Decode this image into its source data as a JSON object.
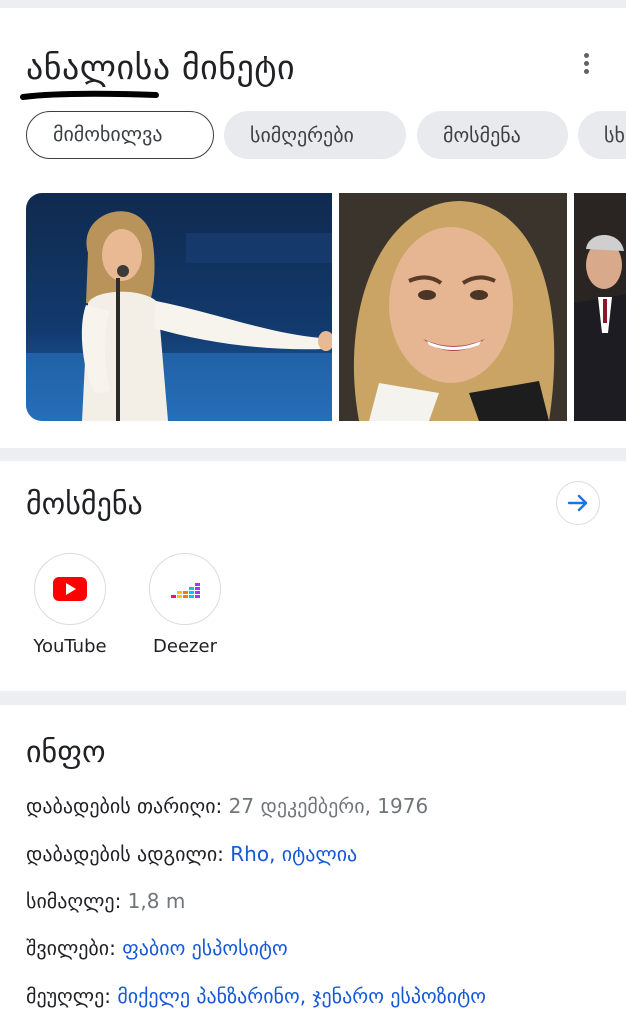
{
  "header": {
    "title": "ანალისა მინეტი",
    "menu_icon": "more-vert-icon"
  },
  "chips": [
    {
      "label": "მიმოხილვა",
      "selected": true
    },
    {
      "label": "სიმღერები",
      "selected": false
    },
    {
      "label": "მოსმენა",
      "selected": false
    },
    {
      "label": "სხ",
      "selected": false
    }
  ],
  "images": [
    {
      "alt": "singer performing on stage with microphone"
    },
    {
      "alt": "portrait close-up"
    },
    {
      "alt": "man in suit"
    }
  ],
  "listen": {
    "title": "მოსმენა",
    "arrow_icon": "arrow-right-icon",
    "sources": [
      {
        "label": "YouTube",
        "icon": "youtube-icon"
      },
      {
        "label": "Deezer",
        "icon": "deezer-icon"
      }
    ]
  },
  "info": {
    "title": "ინფო",
    "rows": [
      {
        "key": "დაბადების თარიღი:",
        "value": "27 დეკემბერი, 1976",
        "link": false
      },
      {
        "key": "დაბადების ადგილი:",
        "value": "Rho, იტალია",
        "link": true
      },
      {
        "key": "სიმაღლე:",
        "value": "1,8 m",
        "link": false
      },
      {
        "key": "შვილები:",
        "value": "ფაბიო ესპოსიტო",
        "link": true
      },
      {
        "key": "მეუღლე:",
        "value": "მიქელე პანზარინო, ჯენარო ესპოზიტო",
        "link": true
      }
    ]
  },
  "colors": {
    "background": "#eceef1",
    "card": "#ffffff",
    "link": "#1558d6",
    "muted": "#70757a",
    "accent_blue": "#1a73e8"
  }
}
